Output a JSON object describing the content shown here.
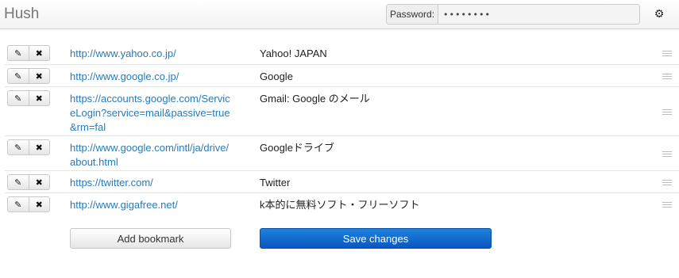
{
  "header": {
    "brand": "Hush",
    "password_label": "Password:",
    "password_value": "••••••••",
    "settings_icon": "gear-icon"
  },
  "rows": [
    {
      "url": "http://www.yahoo.co.jp/",
      "title": "Yahoo! JAPAN"
    },
    {
      "url": "http://www.google.co.jp/",
      "title": "Google"
    },
    {
      "url": "https://accounts.google.com/ServiceLogin?service=mail&passive=true&rm=fal",
      "title": "Gmail: Google のメール"
    },
    {
      "url": "http://www.google.com/intl/ja/drive/about.html",
      "title": "Googleドライブ"
    },
    {
      "url": "https://twitter.com/",
      "title": "Twitter"
    },
    {
      "url": "http://www.gigafree.net/",
      "title": "k本的に無料ソフト・フリーソフト"
    }
  ],
  "row_icons": {
    "edit": "edit-icon",
    "delete": "delete-icon",
    "handle": "drag-handle-icon"
  },
  "actions": {
    "add_label": "Add bookmark",
    "save_label": "Save changes"
  },
  "colors": {
    "link": "#2a7ab8",
    "primary": "#0a57c2"
  }
}
